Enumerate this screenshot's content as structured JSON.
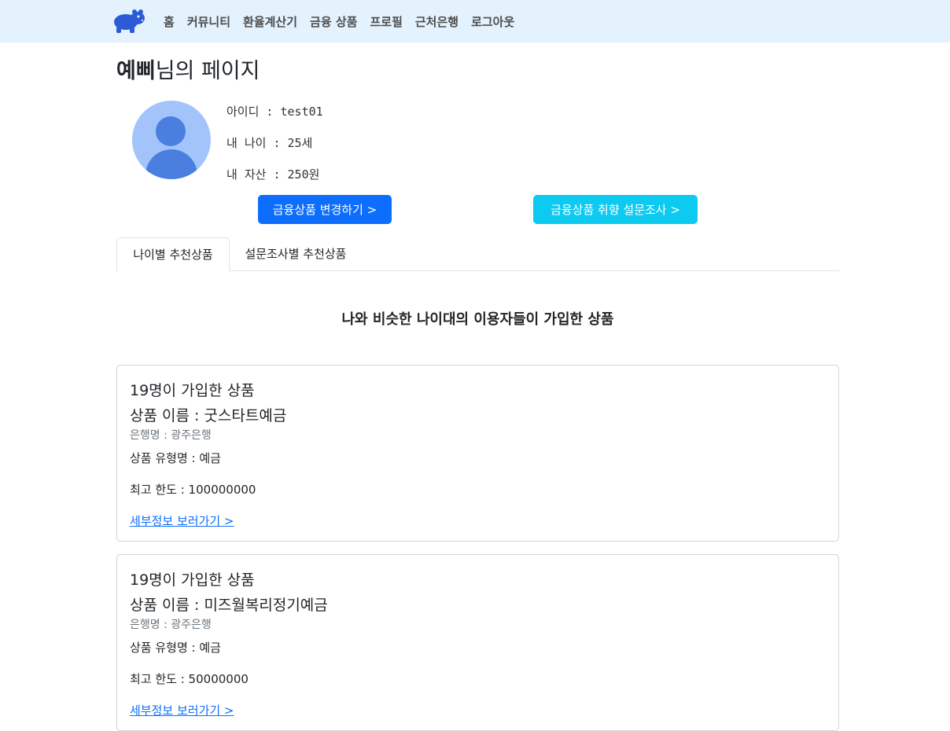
{
  "nav": {
    "logo_icon": "hippo-logo-icon",
    "links": [
      "홈",
      "커뮤니티",
      "환율계산기",
      "금융 상품",
      "프로필",
      "근처은행",
      "로그아웃"
    ]
  },
  "profile": {
    "username": "예삐",
    "title_suffix": "님의 페이지",
    "avatar_icon": "user-avatar-icon",
    "id_line": "아이디 : test01",
    "age_line": "내 나이 : 25세",
    "asset_line": "내 자산 : 250원"
  },
  "buttons": {
    "change_product": "금융상품 변경하기 >",
    "survey": "금융상품 취향 설문조사 >"
  },
  "tabs": {
    "age": "나이별 추천상품",
    "survey": "설문조사별 추천상품"
  },
  "section_heading": "나와 비슷한 나이대의 이용자들이 가입한 상품",
  "products": [
    {
      "joined": "19명이 가입한 상품",
      "name": "상품 이름 : 굿스타트예금",
      "bank": "은행명 : 광주은행",
      "type": "상품 유형명 : 예금",
      "limit": "최고 한도 : 100000000",
      "link": "세부정보 보러가기 >"
    },
    {
      "joined": "19명이 가입한 상품",
      "name": "상품 이름 : 미즈월복리정기예금",
      "bank": "은행명 : 광주은행",
      "type": "상품 유형명 : 예금",
      "limit": "최고 한도 : 50000000",
      "link": "세부정보 보러가기 >"
    }
  ],
  "colors": {
    "navbar_bg": "#e3f2fd",
    "primary": "#0d6efd",
    "info": "#0dcaf0",
    "logo": "#2b5cd6"
  }
}
